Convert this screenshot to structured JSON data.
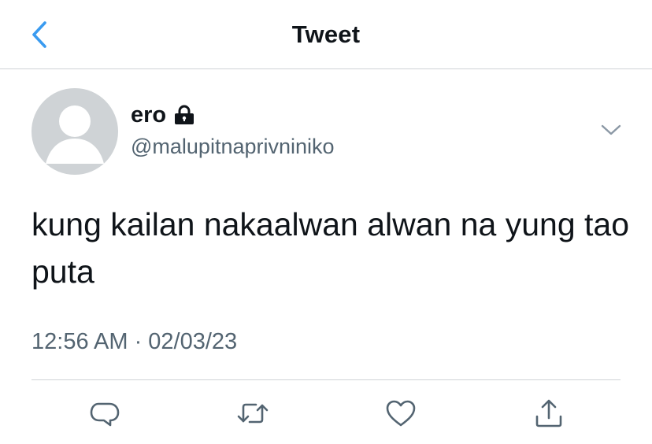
{
  "header": {
    "title": "Tweet",
    "back_icon": "chevron-left-icon"
  },
  "tweet": {
    "author": {
      "display_name": "ero",
      "handle": "@malupitnaprivniniko",
      "protected_icon": "lock-icon",
      "avatar_icon": "default-avatar-icon"
    },
    "text": "kung kailan nakaalwan alwan na yung tao puta",
    "timestamp": "12:56 AM · 02/03/23",
    "menu_icon": "chevron-down-icon"
  },
  "actions": [
    {
      "name": "reply",
      "icon": "reply-icon"
    },
    {
      "name": "retweet",
      "icon": "retweet-icon"
    },
    {
      "name": "like",
      "icon": "heart-icon"
    },
    {
      "name": "share",
      "icon": "share-icon"
    }
  ],
  "colors": {
    "accent": "#1d9bf0",
    "secondary_text": "#536471",
    "primary_text": "#0f1419",
    "divider": "#cfd3d6",
    "avatar_bg": "#cfd3d6"
  }
}
